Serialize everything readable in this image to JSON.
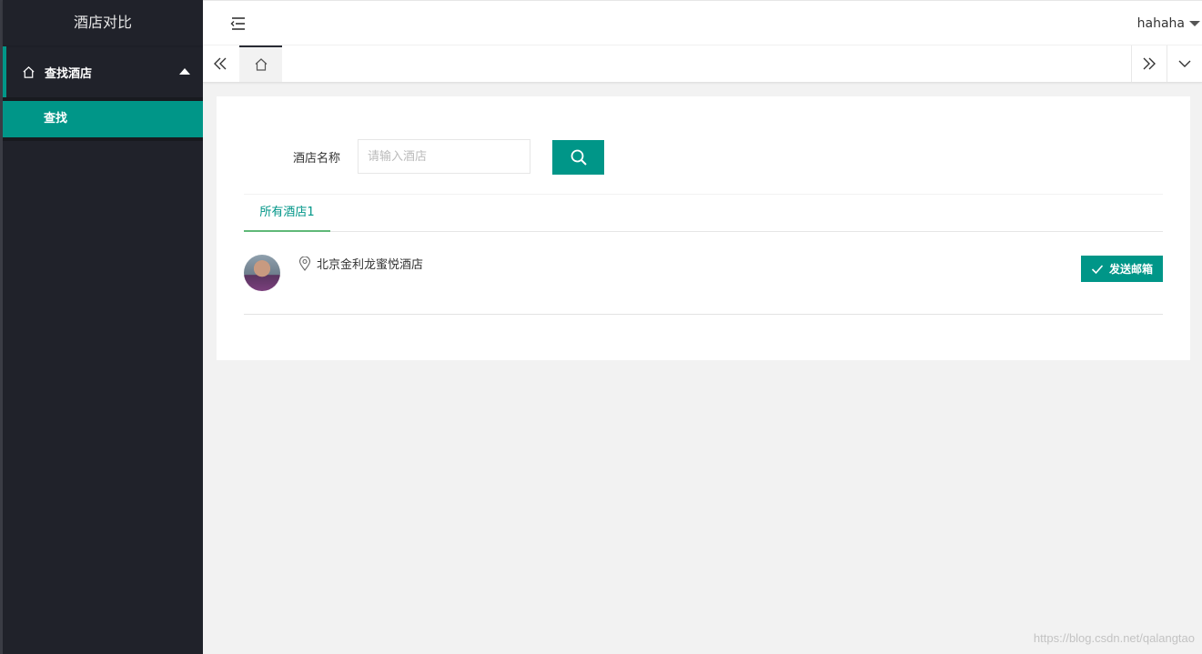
{
  "sidebar": {
    "logo": "酒店对比",
    "group_label": "查找酒店",
    "sub_items": [
      {
        "label": "查找"
      }
    ]
  },
  "header": {
    "username": "hahaha"
  },
  "search": {
    "label": "酒店名称",
    "placeholder": "请输入酒店"
  },
  "tabs": [
    {
      "label": "所有酒店1"
    }
  ],
  "hotels": [
    {
      "name": "北京金利龙蜜悦酒店",
      "action_label": "发送邮箱"
    }
  ],
  "watermark": "https://blog.csdn.net/qalangtao",
  "colors": {
    "accent": "#009688",
    "sidebar_bg": "#20222a",
    "page_bg": "#f2f2f2"
  }
}
